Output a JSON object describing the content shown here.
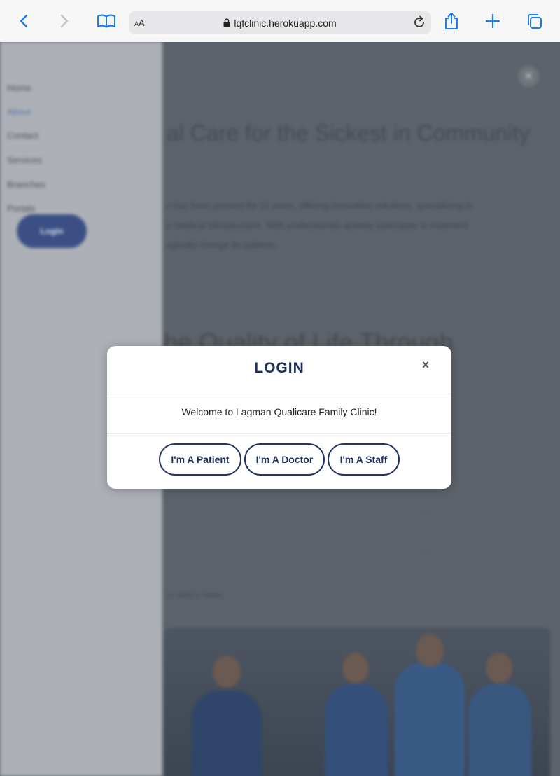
{
  "browser": {
    "text_size_label_small": "A",
    "text_size_label_large": "A",
    "url": "lqfclinic.herokuapp.com",
    "icons": [
      "back-icon",
      "forward-icon",
      "bookmarks-icon",
      "lock-icon",
      "reload-icon",
      "share-icon",
      "new-tab-icon",
      "tabs-icon"
    ]
  },
  "background_page": {
    "nav_items": [
      "Home",
      "About",
      "Contact",
      "Services",
      "Branches",
      "Portals"
    ],
    "nav_login_label": "Login",
    "close_label": "✕",
    "hero_title": "al Care for the Sickest in Community",
    "hero_paragraph": [
      "c has been present for 11 years, offering innovative solutions, specializing in",
      "e medical infrastructure. With professionals actively participate in treatment",
      "ogically change its patients."
    ],
    "quality_title": "he Quality of Life Through",
    "body_lines": [
      "...",
      "...",
      "...",
      "..."
    ],
    "photo_caption": "rs, clinic's owner"
  },
  "modal": {
    "title": "LOGIN",
    "close_label": "×",
    "welcome_text": "Welcome to Lagman Qualicare Family Clinic!",
    "buttons": {
      "patient": "I'm A Patient",
      "doctor": "I'm A Doctor",
      "staff": "I'm A Staff"
    }
  },
  "colors": {
    "brand_navy": "#1f2f5c",
    "overlay": "#5d636b",
    "sidebar": "#adb1b7",
    "browser_accent": "#1a7ef2"
  }
}
